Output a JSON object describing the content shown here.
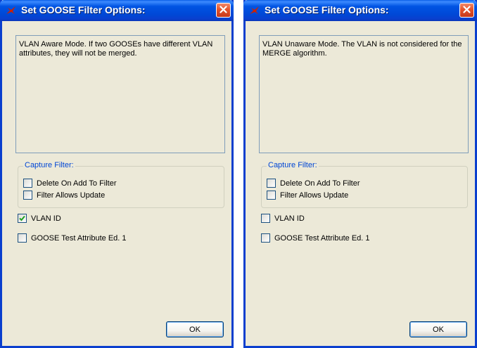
{
  "icon_colors": {
    "title_icon": "#cc2200",
    "close_x": "#ffffff",
    "checkmark": "#21a121"
  },
  "dialogs": [
    {
      "title": "Set GOOSE Filter Options:",
      "icons": {
        "app": "goose-logo-icon",
        "close": "close-icon"
      },
      "description": "VLAN Aware Mode. If two GOOSEs have different VLAN attributes, they will not be merged.",
      "capture_filter": {
        "label": "Capture Filter:",
        "delete_on_add": {
          "label": "Delete On Add To Filter",
          "checked": false
        },
        "filter_allows_update": {
          "label": "Filter Allows Update",
          "checked": false
        }
      },
      "vlan_id": {
        "label": "VLAN ID",
        "checked": true
      },
      "goose_test": {
        "label": "GOOSE Test Attribute Ed. 1",
        "checked": false
      },
      "ok_label": "OK"
    },
    {
      "title": "Set GOOSE Filter Options:",
      "icons": {
        "app": "goose-logo-icon",
        "close": "close-icon"
      },
      "description": "VLAN Unaware Mode. The VLAN is not considered for the MERGE algorithm.",
      "capture_filter": {
        "label": "Capture Filter:",
        "delete_on_add": {
          "label": "Delete On Add To Filter",
          "checked": false
        },
        "filter_allows_update": {
          "label": "Filter Allows Update",
          "checked": false
        }
      },
      "vlan_id": {
        "label": "VLAN ID",
        "checked": false
      },
      "goose_test": {
        "label": "GOOSE Test Attribute Ed. 1",
        "checked": false
      },
      "ok_label": "OK"
    }
  ]
}
